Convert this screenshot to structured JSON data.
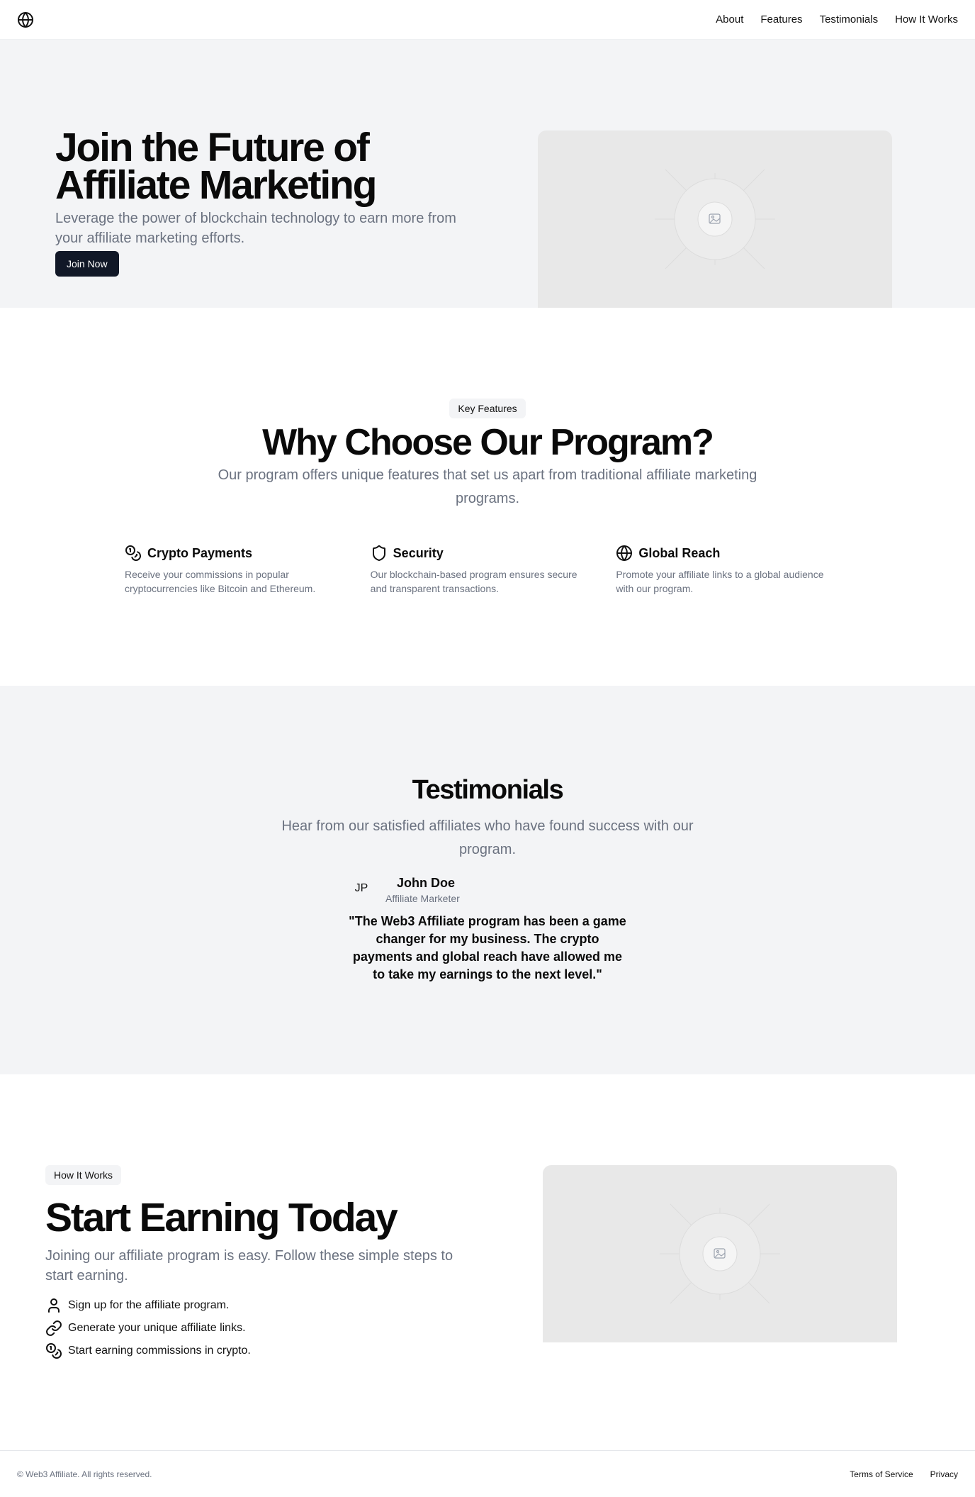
{
  "nav": {
    "logo_icon": "globe-icon",
    "links": [
      "About",
      "Features",
      "Testimonials",
      "How It Works"
    ]
  },
  "hero": {
    "title": "Join the Future of Affiliate Marketing",
    "subtitle": "Leverage the power of blockchain technology to earn more from your affiliate marketing efforts.",
    "cta": "Join Now",
    "image_icon": "image-placeholder-icon"
  },
  "features": {
    "badge": "Key Features",
    "title": "Why Choose Our Program?",
    "subtitle": "Our program offers unique features that set us apart from traditional affiliate marketing programs.",
    "items": [
      {
        "icon": "coins-icon",
        "name": "Crypto Payments",
        "desc": "Receive your commissions in popular cryptocurrencies like Bitcoin and Ethereum."
      },
      {
        "icon": "shield-icon",
        "name": "Security",
        "desc": "Our blockchain-based program ensures secure and transparent transactions."
      },
      {
        "icon": "globe-icon",
        "name": "Global Reach",
        "desc": "Promote your affiliate links to a global audience with our program."
      }
    ]
  },
  "testimonials": {
    "title": "Testimonials",
    "subtitle": "Hear from our satisfied affiliates who have found success with our program.",
    "avatar": "JP",
    "name": "John Doe",
    "role": "Affiliate Marketer",
    "quote": "\"The Web3 Affiliate program has been a game changer for my business. The crypto payments and global reach have allowed me to take my earnings to the next level.\""
  },
  "how": {
    "badge": "How It Works",
    "title": "Start Earning Today",
    "subtitle": "Joining our affiliate program is easy. Follow these simple steps to start earning.",
    "steps": [
      {
        "icon": "user-icon",
        "text": "Sign up for the affiliate program."
      },
      {
        "icon": "link-icon",
        "text": "Generate your unique affiliate links."
      },
      {
        "icon": "coins-icon",
        "text": "Start earning commissions in crypto."
      }
    ]
  },
  "footer": {
    "copyright": "© Web3 Affiliate. All rights reserved.",
    "links": [
      "Terms of Service",
      "Privacy"
    ]
  },
  "colors": {
    "accent": "#111827",
    "section_bg": "#f3f4f6",
    "muted_text": "#6b7280",
    "placeholder_bg": "#e8e8e8"
  }
}
